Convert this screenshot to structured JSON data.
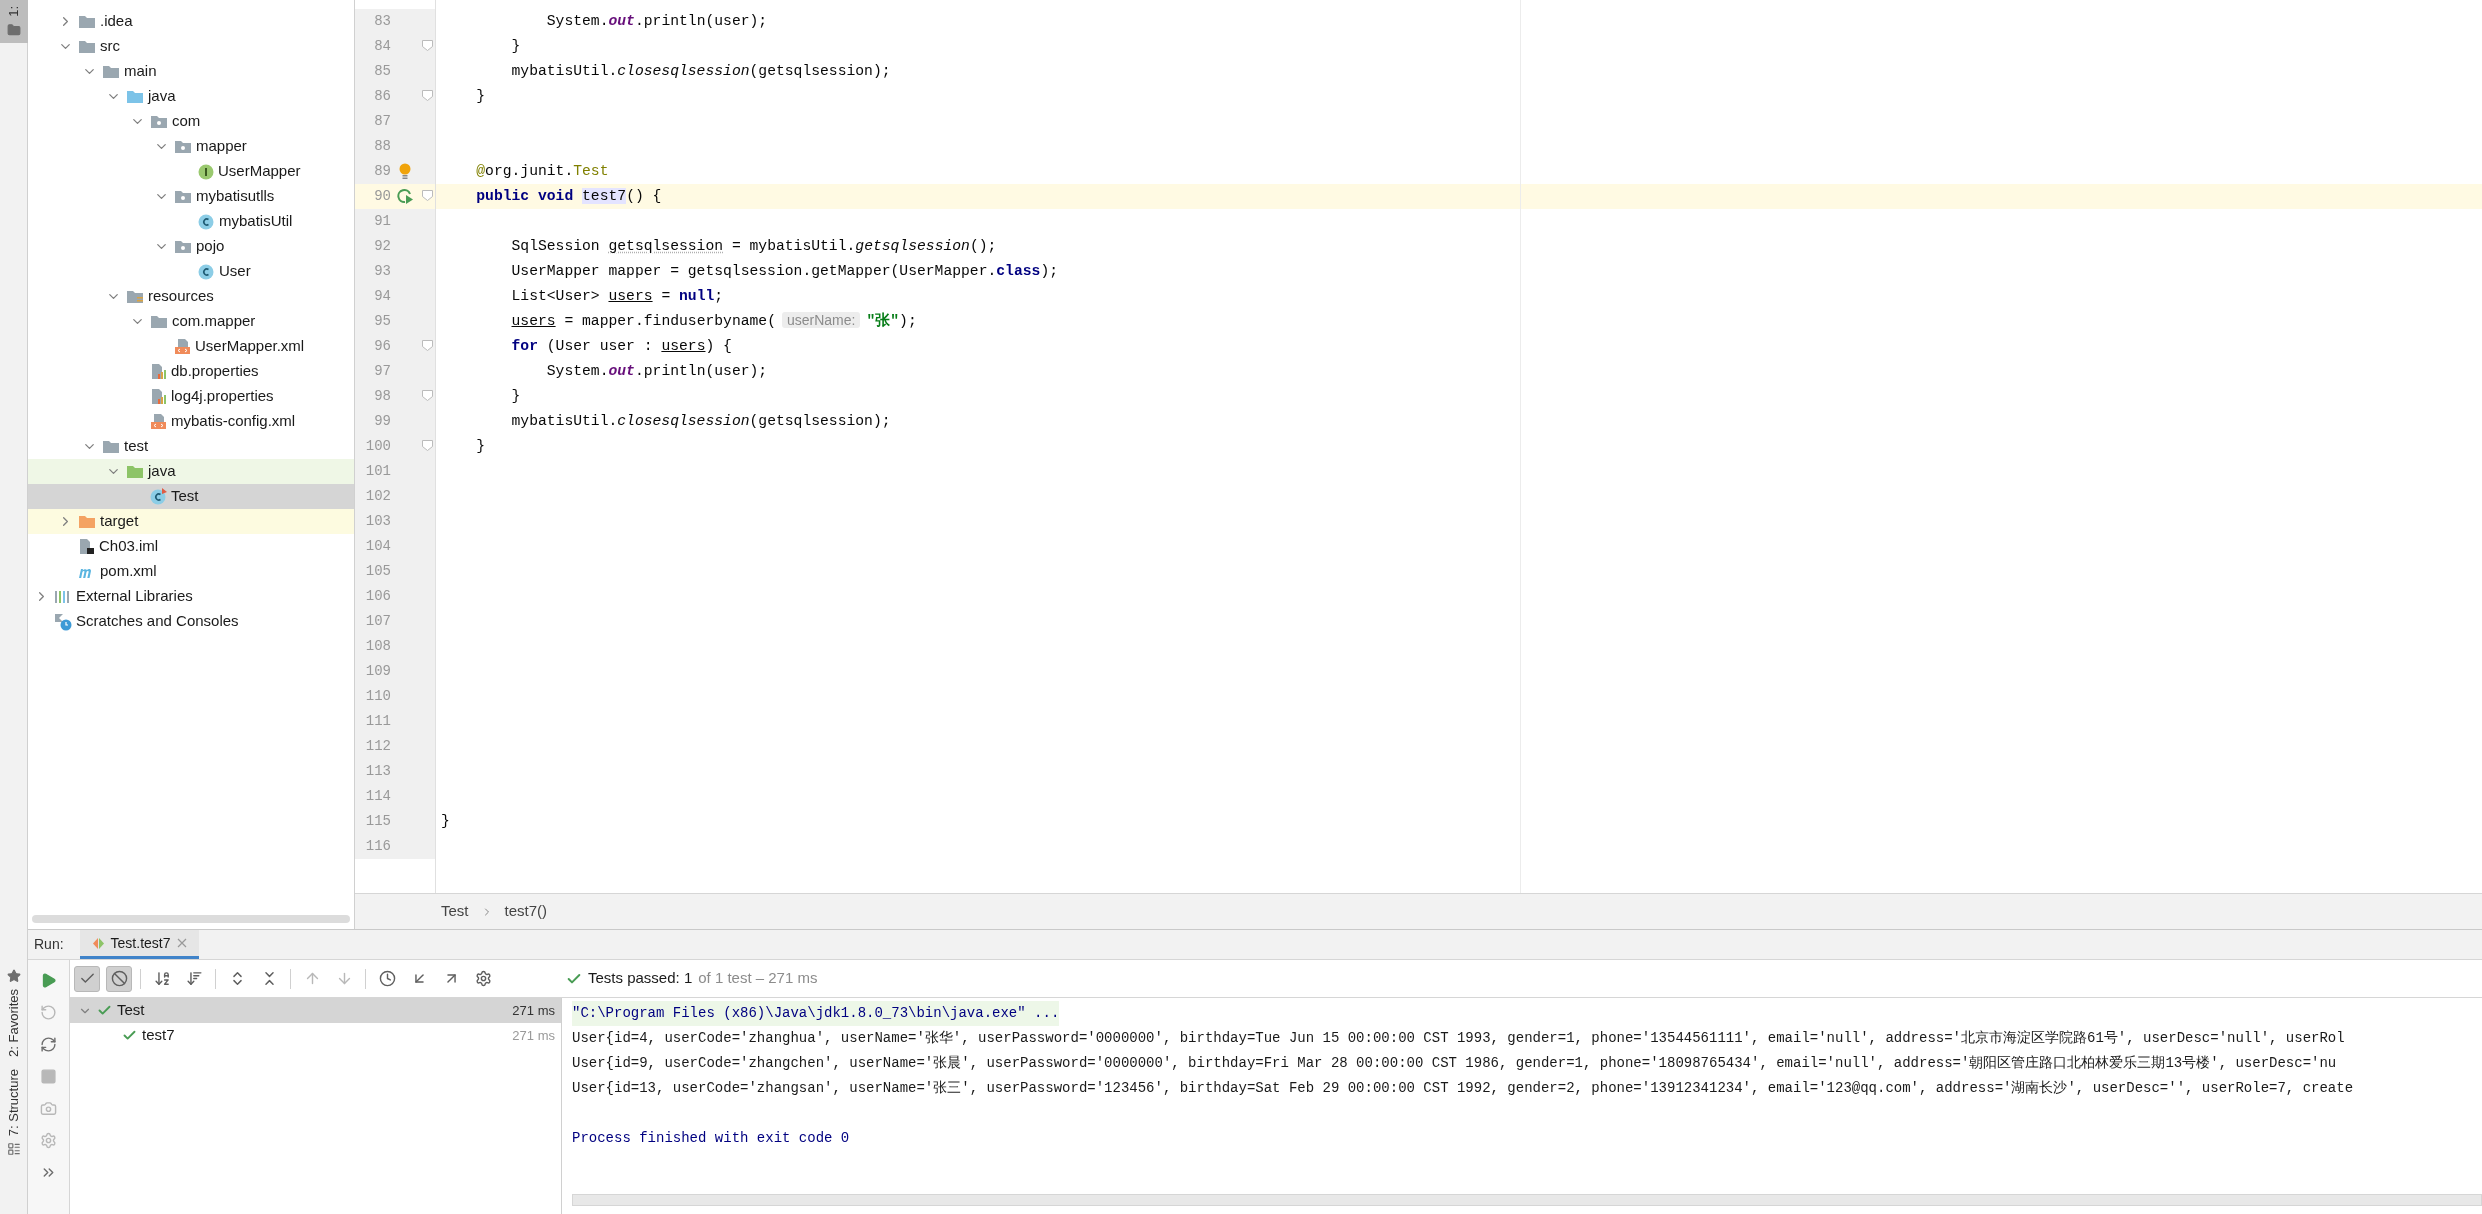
{
  "left_stripe": {
    "tabs": [
      {
        "label": "1:",
        "selected": true,
        "kind": "project"
      },
      {
        "label": "2: Favorites",
        "selected": false,
        "kind": "favorites"
      },
      {
        "label": "7: Structure",
        "selected": false,
        "kind": "structure"
      }
    ]
  },
  "project_tree": {
    "items": [
      {
        "label": ".idea",
        "kind": "folder",
        "expanded": false,
        "selected": false
      },
      {
        "label": "src",
        "kind": "folder",
        "expanded": true,
        "selected": false,
        "children": [
          {
            "label": "main",
            "kind": "folder",
            "expanded": true,
            "selected": false,
            "children": [
              {
                "label": "java",
                "kind": "source-folder",
                "expanded": true,
                "selected": false,
                "children": [
                  {
                    "label": "com",
                    "kind": "package",
                    "expanded": true,
                    "selected": false,
                    "children": [
                      {
                        "label": "mapper",
                        "kind": "package",
                        "expanded": true,
                        "selected": false,
                        "children": [
                          {
                            "label": "UserMapper",
                            "kind": "interface",
                            "selected": false
                          }
                        ]
                      },
                      {
                        "label": "mybatisutlls",
                        "kind": "package",
                        "expanded": true,
                        "selected": false,
                        "children": [
                          {
                            "label": "mybatisUtil",
                            "kind": "class",
                            "selected": false
                          }
                        ]
                      },
                      {
                        "label": "pojo",
                        "kind": "package",
                        "expanded": true,
                        "selected": false,
                        "children": [
                          {
                            "label": "User",
                            "kind": "class",
                            "selected": false
                          }
                        ]
                      }
                    ]
                  }
                ]
              },
              {
                "label": "resources",
                "kind": "resources-folder",
                "expanded": true,
                "selected": false,
                "children": [
                  {
                    "label": "com.mapper",
                    "kind": "folder",
                    "expanded": true,
                    "selected": false,
                    "children": [
                      {
                        "label": "UserMapper.xml",
                        "kind": "xml",
                        "selected": false
                      }
                    ]
                  },
                  {
                    "label": "db.properties",
                    "kind": "properties",
                    "selected": false
                  },
                  {
                    "label": "log4j.properties",
                    "kind": "properties",
                    "selected": false
                  },
                  {
                    "label": "mybatis-config.xml",
                    "kind": "xml",
                    "selected": false
                  }
                ]
              }
            ]
          },
          {
            "label": "test",
            "kind": "folder",
            "expanded": true,
            "selected": false,
            "children": [
              {
                "label": "java",
                "kind": "test-folder",
                "expanded": true,
                "selected": false,
                "children": [
                  {
                    "label": "Test",
                    "kind": "test-class",
                    "selected": true
                  }
                ]
              }
            ]
          }
        ]
      },
      {
        "label": "target",
        "kind": "excluded-folder",
        "expanded": false,
        "selected": false
      },
      {
        "label": "Ch03.iml",
        "kind": "iml",
        "selected": false
      },
      {
        "label": "pom.xml",
        "kind": "maven",
        "selected": false
      }
    ],
    "roots": [
      {
        "label": "External Libraries",
        "kind": "libraries",
        "expanded": false,
        "selected": false
      },
      {
        "label": "Scratches and Consoles",
        "kind": "scratches",
        "selected": false
      }
    ]
  },
  "editor": {
    "lines": [
      {
        "number": "83",
        "current": false,
        "fold": false,
        "tokens": [
          {
            "text": "            System.",
            "kind": "t"
          },
          {
            "text": "out",
            "kind": "fld"
          },
          {
            "text": ".println(user);",
            "kind": "t"
          }
        ]
      },
      {
        "number": "84",
        "current": false,
        "fold": true,
        "tokens": [
          {
            "text": "        }",
            "kind": "t"
          }
        ]
      },
      {
        "number": "85",
        "current": false,
        "fold": false,
        "tokens": [
          {
            "text": "        mybatisUtil.",
            "kind": "t"
          },
          {
            "text": "closesqlsession",
            "kind": "st"
          },
          {
            "text": "(getsqlsession);",
            "kind": "t"
          }
        ]
      },
      {
        "number": "86",
        "current": false,
        "fold": true,
        "tokens": [
          {
            "text": "    }",
            "kind": "t"
          }
        ]
      },
      {
        "number": "87",
        "current": false,
        "fold": false
      },
      {
        "number": "88",
        "current": false,
        "fold": false
      },
      {
        "number": "89",
        "current": false,
        "fold": false,
        "kind": "bulb",
        "tokens": [
          {
            "text": "    @",
            "kind": "ann"
          },
          {
            "text": "org.junit.",
            "kind": "t"
          },
          {
            "text": "Test",
            "kind": "ann"
          }
        ]
      },
      {
        "number": "90",
        "current": true,
        "fold": true,
        "kind": "run",
        "tokens": [
          {
            "text": "    public void ",
            "kind": "kw"
          },
          {
            "text": "test7",
            "kind": "hl"
          },
          {
            "text": "() {",
            "kind": "t"
          }
        ]
      },
      {
        "number": "91",
        "current": false,
        "fold": false
      },
      {
        "number": "92",
        "current": false,
        "fold": false,
        "tokens": [
          {
            "text": "        SqlSession ",
            "kind": "t"
          },
          {
            "text": "getsqlsession",
            "kind": "warn"
          },
          {
            "text": " = mybatisUtil.",
            "kind": "t"
          },
          {
            "text": "getsqlsession",
            "kind": "st"
          },
          {
            "text": "();",
            "kind": "t"
          }
        ]
      },
      {
        "number": "93",
        "current": false,
        "fold": false,
        "tokens": [
          {
            "text": "        UserMapper mapper = getsqlsession.getMapper(UserMapper.",
            "kind": "t"
          },
          {
            "text": "class",
            "kind": "kw"
          },
          {
            "text": ");",
            "kind": "t"
          }
        ]
      },
      {
        "number": "94",
        "current": false,
        "fold": false,
        "tokens": [
          {
            "text": "        List<User> ",
            "kind": "t"
          },
          {
            "text": "users",
            "kind": "ul"
          },
          {
            "text": " = ",
            "kind": "t"
          },
          {
            "text": "null",
            "kind": "kw"
          },
          {
            "text": ";",
            "kind": "t"
          }
        ]
      },
      {
        "number": "95",
        "current": false,
        "fold": false,
        "tokens": [
          {
            "text": "        users",
            "kind": "ul"
          },
          {
            "text": " = mapper.finduserbyname(",
            "kind": "t"
          },
          {
            "text": "userName:",
            "kind": "hint"
          },
          {
            "text": "\"张\"",
            "kind": "str"
          },
          {
            "text": ");",
            "kind": "t"
          }
        ]
      },
      {
        "number": "96",
        "current": false,
        "fold": true,
        "tokens": [
          {
            "text": "        for",
            "kind": "kw"
          },
          {
            "text": " (User user : ",
            "kind": "t"
          },
          {
            "text": "users",
            "kind": "ul"
          },
          {
            "text": ") {",
            "kind": "t"
          }
        ]
      },
      {
        "number": "97",
        "current": false,
        "fold": false,
        "tokens": [
          {
            "text": "            System.",
            "kind": "t"
          },
          {
            "text": "out",
            "kind": "fld"
          },
          {
            "text": ".println(user);",
            "kind": "t"
          }
        ]
      },
      {
        "number": "98",
        "current": false,
        "fold": true,
        "tokens": [
          {
            "text": "        }",
            "kind": "t"
          }
        ]
      },
      {
        "number": "99",
        "current": false,
        "fold": false,
        "tokens": [
          {
            "text": "        mybatisUtil.",
            "kind": "t"
          },
          {
            "text": "closesqlsession",
            "kind": "st"
          },
          {
            "text": "(getsqlsession);",
            "kind": "t"
          }
        ]
      },
      {
        "number": "100",
        "current": false,
        "fold": true,
        "tokens": [
          {
            "text": "    }",
            "kind": "t"
          }
        ]
      },
      {
        "number": "101",
        "current": false,
        "fold": false
      },
      {
        "number": "102",
        "current": false,
        "fold": false
      },
      {
        "number": "103",
        "current": false,
        "fold": false
      },
      {
        "number": "104",
        "current": false,
        "fold": false
      },
      {
        "number": "105",
        "current": false,
        "fold": false
      },
      {
        "number": "106",
        "current": false,
        "fold": false
      },
      {
        "number": "107",
        "current": false,
        "fold": false
      },
      {
        "number": "108",
        "current": false,
        "fold": false
      },
      {
        "number": "109",
        "current": false,
        "fold": false
      },
      {
        "number": "110",
        "current": false,
        "fold": false
      },
      {
        "number": "111",
        "current": false,
        "fold": false
      },
      {
        "number": "112",
        "current": false,
        "fold": false
      },
      {
        "number": "113",
        "current": false,
        "fold": false
      },
      {
        "number": "114",
        "current": false,
        "fold": false
      },
      {
        "number": "115",
        "current": false,
        "fold": false,
        "tokens": [
          {
            "text": "}",
            "kind": "t"
          }
        ]
      },
      {
        "number": "116",
        "current": false,
        "fold": false
      }
    ],
    "breadcrumbs": [
      "Test",
      "test7()"
    ]
  },
  "run_panel": {
    "label": "Run:",
    "tabs": [
      {
        "label": "Test.test7",
        "selected": true
      }
    ],
    "side_toolbar": [
      {
        "kind": "run",
        "disabled": false
      },
      {
        "kind": "rerun-failed",
        "disabled": true
      },
      {
        "kind": "toggle-auto",
        "disabled": false
      },
      {
        "kind": "stop",
        "disabled": true
      },
      {
        "kind": "camera",
        "disabled": true
      },
      {
        "kind": "settings",
        "disabled": true
      },
      {
        "kind": "more",
        "disabled": false
      }
    ],
    "toolbar": [
      {
        "kind": "check",
        "on": true
      },
      {
        "kind": "ban",
        "on": true
      },
      {
        "kind": "sort-alpha",
        "on": false
      },
      {
        "kind": "sort-duration",
        "on": false
      },
      {
        "kind": "expand",
        "on": false
      },
      {
        "kind": "collapse",
        "on": false
      },
      {
        "kind": "up",
        "on": false
      },
      {
        "kind": "down",
        "on": false
      },
      {
        "kind": "history",
        "on": false
      },
      {
        "kind": "import",
        "on": false
      },
      {
        "kind": "export",
        "on": false
      },
      {
        "kind": "gear",
        "on": false
      }
    ],
    "status": {
      "passed": "Tests passed: 1",
      "detail": "of 1 test – 271 ms"
    },
    "tests": [
      {
        "label": "Test",
        "time": "271 ms",
        "expanded": true,
        "selected": true,
        "children": [
          {
            "label": "test7",
            "time": "271 ms",
            "selected": false
          }
        ]
      }
    ],
    "console": [
      {
        "kind": "command",
        "text": "\"C:\\Program Files (x86)\\Java\\jdk1.8.0_73\\bin\\java.exe\" ..."
      },
      {
        "kind": "output",
        "text": "User{id=4, userCode='zhanghua', userName='张华', userPassword='0000000', birthday=Tue Jun 15 00:00:00 CST 1993, gender=1, phone='13544561111', email='null', address='北京市海淀区学院路61号', userDesc='null', userRol"
      },
      {
        "kind": "output",
        "text": "User{id=9, userCode='zhangchen', userName='张晨', userPassword='0000000', birthday=Fri Mar 28 00:00:00 CST 1986, gender=1, phone='18098765434', email='null', address='朝阳区管庄路口北柏林爱乐三期13号楼', userDesc='nu"
      },
      {
        "kind": "output",
        "text": "User{id=13, userCode='zhangsan', userName='张三', userPassword='123456', birthday=Sat Feb 29 00:00:00 CST 1992, gender=2, phone='13912341234', email='123@qq.com', address='湖南长沙', userDesc='', userRole=7, create"
      },
      {
        "kind": "blank"
      },
      {
        "kind": "system",
        "text": "Process finished with exit code 0"
      }
    ]
  }
}
